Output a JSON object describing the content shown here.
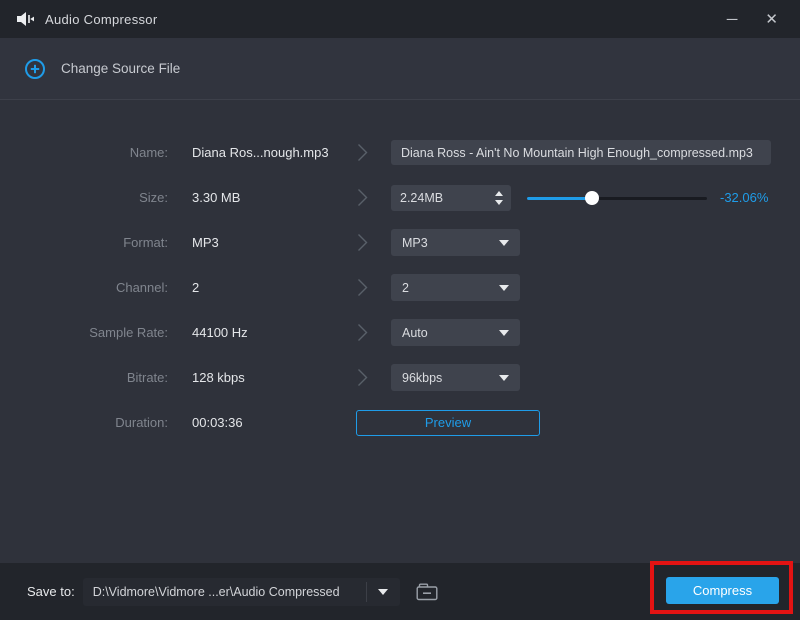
{
  "titlebar": {
    "title": "Audio Compressor",
    "minimize_glyph": "─",
    "close_glyph": "✕"
  },
  "source_bar": {
    "change_source_label": "Change Source File"
  },
  "rows": [
    {
      "label": "Name:",
      "value": "Diana Ros...nough.mp3",
      "control": {
        "type": "text-input",
        "value": "Diana Ross - Ain't No Mountain High Enough_compressed.mp3"
      }
    },
    {
      "label": "Size:",
      "value": "3.30 MB",
      "control": {
        "type": "spinner",
        "value": "2.24MB"
      },
      "slider": {
        "fill_percent": 36,
        "label": "-32.06%"
      }
    },
    {
      "label": "Format:",
      "value": "MP3",
      "control": {
        "type": "dropdown",
        "value": "MP3"
      }
    },
    {
      "label": "Channel:",
      "value": "2",
      "control": {
        "type": "dropdown",
        "value": "2"
      }
    },
    {
      "label": "Sample Rate:",
      "value": "44100 Hz",
      "control": {
        "type": "dropdown",
        "value": "Auto"
      }
    },
    {
      "label": "Bitrate:",
      "value": "128 kbps",
      "control": {
        "type": "dropdown",
        "value": "96kbps"
      }
    },
    {
      "label": "Duration:",
      "value": "00:03:36",
      "control": {
        "type": "button",
        "value": "Preview"
      }
    }
  ],
  "bottom_bar": {
    "save_to_label": "Save to:",
    "path_value": "D:\\Vidmore\\Vidmore ...er\\Audio Compressed",
    "compress_label": "Compress"
  },
  "annotation": {
    "type": "highlight-box",
    "target": "compress-button"
  },
  "icons": {
    "app": "audio-speaker-icon",
    "add_source": "plus-circle-icon",
    "row_arrow": "chevron-right-icon",
    "dropdown": "caret-down-icon",
    "browse": "folder-icon"
  },
  "colors": {
    "accent_blue": "#1f9ce8",
    "compress_blue": "#29a4ea",
    "annotation_red": "#e31313",
    "titlebar_bg": "#22252b",
    "panel_bg": "#2f323b",
    "section_bg": "#31343e",
    "control_bg": "#3f434d"
  }
}
